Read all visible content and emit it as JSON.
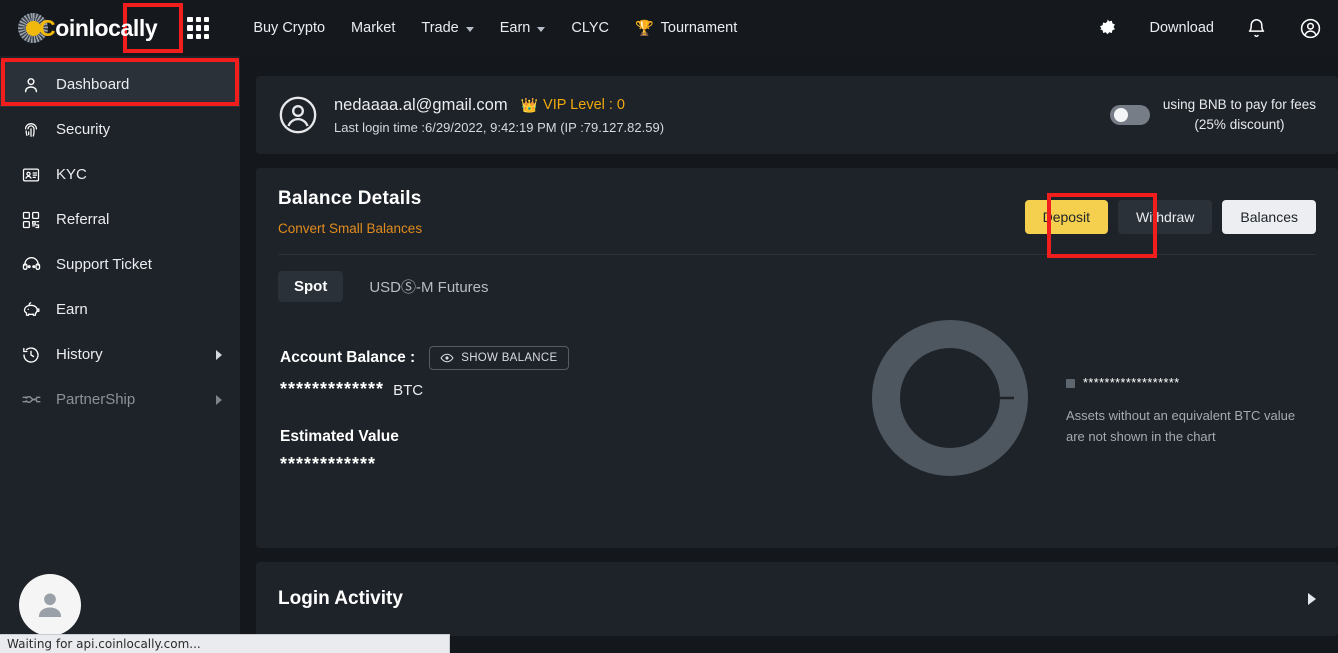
{
  "brand": {
    "logo_c": "C",
    "logo_rest": "oinlocally",
    "accent_gold": "#f0b90b"
  },
  "topnav": {
    "apps_grid_label": "apps-grid",
    "items": [
      {
        "label": "Buy Crypto",
        "has_dropdown": false
      },
      {
        "label": "Market",
        "has_dropdown": false
      },
      {
        "label": "Trade",
        "has_dropdown": true
      },
      {
        "label": "Earn",
        "has_dropdown": true
      },
      {
        "label": "CLYC",
        "has_dropdown": false
      },
      {
        "label": "Tournament",
        "has_dropdown": false,
        "icon": "trophy-icon",
        "glyph": "🏆"
      }
    ],
    "right": {
      "settings_icon": "gear-icon",
      "download_label": "Download",
      "notifications_icon": "bell-icon",
      "account_icon": "user-account-icon"
    }
  },
  "sidebar": {
    "items": [
      {
        "label": "Dashboard",
        "icon": "user-icon",
        "active": true,
        "chevron": false,
        "dim": false
      },
      {
        "label": "Security",
        "icon": "fingerprint-icon",
        "active": false,
        "chevron": false,
        "dim": false
      },
      {
        "label": "KYC",
        "icon": "id-card-icon",
        "active": false,
        "chevron": false,
        "dim": false
      },
      {
        "label": "Referral",
        "icon": "qr-code-icon",
        "active": false,
        "chevron": false,
        "dim": false
      },
      {
        "label": "Support Ticket",
        "icon": "headset-icon",
        "active": false,
        "chevron": false,
        "dim": false
      },
      {
        "label": "Earn",
        "icon": "piggy-bank-icon",
        "active": false,
        "chevron": false,
        "dim": false
      },
      {
        "label": "History",
        "icon": "clock-history-icon",
        "active": false,
        "chevron": true,
        "dim": false
      },
      {
        "label": "PartnerShip",
        "icon": "handshake-icon",
        "active": false,
        "chevron": true,
        "dim": true
      }
    ],
    "avatar_icon": "avatar-placeholder-icon"
  },
  "user_card": {
    "avatar_icon": "user-circle-icon",
    "email": "nedaaaa.al@gmail.com",
    "vip_icon": "crown-icon",
    "vip_glyph": "👑",
    "vip_label": "VIP Level : 0",
    "last_login": "Last login time :6/29/2022, 9:42:19 PM (IP :79.127.82.59)",
    "bnb_toggle_state": "off",
    "bnb_line1": "using BNB to pay for fees",
    "bnb_line2": "(25% discount)"
  },
  "balance": {
    "title": "Balance Details",
    "convert_link": "Convert Small Balances",
    "buttons": {
      "deposit": "Deposit",
      "withdraw": "Withdraw",
      "balances": "Balances"
    },
    "tabs": [
      {
        "label": "Spot",
        "active": true
      },
      {
        "label": "USDⓈ-M Futures",
        "active": false
      }
    ],
    "account_balance_label": "Account Balance :",
    "show_balance_label": "SHOW BALANCE",
    "show_balance_icon": "eye-icon",
    "account_balance_masked": "*************",
    "account_balance_unit": "BTC",
    "estimated_value_label": "Estimated Value",
    "estimated_value_masked": "************",
    "legend_masked": "******************",
    "legend_note": "Assets without an equivalent BTC value are not shown in the chart",
    "chart_data": {
      "type": "pie",
      "title": "Spot balance distribution",
      "labels": [
        "******************"
      ],
      "values": [
        100
      ],
      "colors": [
        "#5d656f"
      ],
      "donut": true,
      "inner_radius_pct": 68,
      "legend_position": "right",
      "note": "Assets without an equivalent BTC value are not shown in the chart"
    }
  },
  "login_activity": {
    "title": "Login Activity",
    "chevron_icon": "chevron-right-icon"
  },
  "status_bar": {
    "text": "Waiting for api.coinlocally.com..."
  },
  "annotations": {
    "highlight_color": "#f21d1d",
    "boxes": [
      "apps-grid-button",
      "sidebar-dashboard",
      "deposit-button"
    ]
  }
}
